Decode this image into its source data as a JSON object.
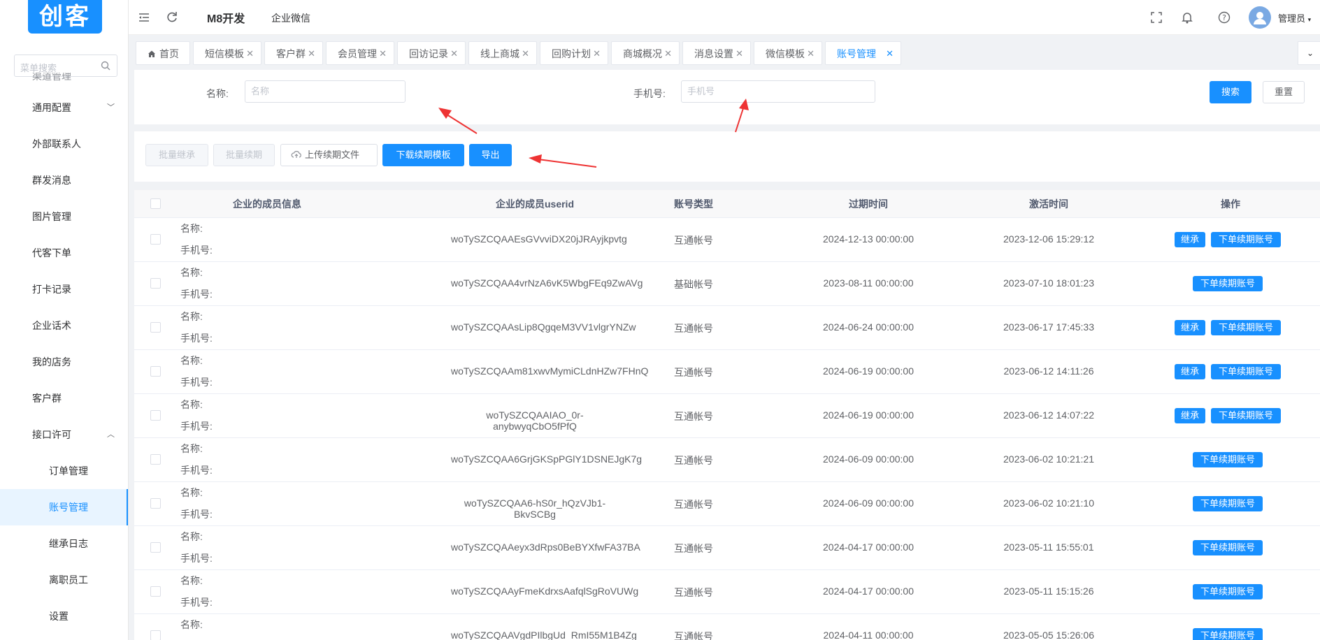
{
  "logo": "创客",
  "sidebar": {
    "search_placeholder": "菜单搜索",
    "items": [
      {
        "label": "渠道管理",
        "type": "cut"
      },
      {
        "label": "通用配置",
        "arrow": "⌄"
      },
      {
        "label": "外部联系人"
      },
      {
        "label": "群发消息"
      },
      {
        "label": "图片管理"
      },
      {
        "label": "代客下单"
      },
      {
        "label": "打卡记录"
      },
      {
        "label": "企业话术"
      },
      {
        "label": "我的店务"
      },
      {
        "label": "客户群"
      },
      {
        "label": "接口许可",
        "arrow": "⌃"
      },
      {
        "label": "订单管理",
        "sub": true
      },
      {
        "label": "账号管理",
        "sub": true,
        "active": true
      },
      {
        "label": "继承日志",
        "sub": true
      },
      {
        "label": "离职员工",
        "sub": true
      },
      {
        "label": "设置",
        "sub": true
      }
    ]
  },
  "header": {
    "title": "M8开发",
    "subtitle": "企业微信",
    "user": "管理员"
  },
  "tabs": [
    {
      "label": "首页",
      "home": true
    },
    {
      "label": "短信模板"
    },
    {
      "label": "客户群"
    },
    {
      "label": "会员管理"
    },
    {
      "label": "回访记录"
    },
    {
      "label": "线上商城"
    },
    {
      "label": "回购计划"
    },
    {
      "label": "商城概况"
    },
    {
      "label": "消息设置"
    },
    {
      "label": "微信模板"
    },
    {
      "label": "账号管理",
      "active": true
    }
  ],
  "search": {
    "name_label": "名称:",
    "name_placeholder": "名称",
    "phone_label": "手机号:",
    "phone_placeholder": "手机号",
    "search_btn": "搜索",
    "reset_btn": "重置"
  },
  "toolbar": {
    "batch_inherit": "批量继承",
    "batch_renew": "批量续期",
    "upload": "上传续期文件",
    "download_template": "下载续期模板",
    "export": "导出"
  },
  "table": {
    "headers": [
      "企业的成员信息",
      "企业的成员userid",
      "账号类型",
      "过期时间",
      "激活时间",
      "操作"
    ],
    "name_prefix": "名称:",
    "phone_prefix": "手机号:",
    "inherit_label": "继承",
    "renew_label": "下单续期账号",
    "rows": [
      {
        "userid": "woTySZCQAAEsGVvviDX20jJRAyjkpvtg",
        "type": "互通帐号",
        "expire": "2024-12-13 00:00:00",
        "activate": "2023-12-06 15:29:12",
        "inherit": true
      },
      {
        "userid": "woTySZCQAA4vrNzA6vK5WbgFEq9ZwAVg",
        "type": "基础帐号",
        "expire": "2023-08-11 00:00:00",
        "activate": "2023-07-10 18:01:23",
        "inherit": false
      },
      {
        "userid": "woTySZCQAAsLip8QgqeM3VV1vlgrYNZw",
        "type": "互通帐号",
        "expire": "2024-06-24 00:00:00",
        "activate": "2023-06-17 17:45:33",
        "inherit": true
      },
      {
        "userid": "woTySZCQAAm81xwvMymiCLdnHZw7FHnQ",
        "type": "互通帐号",
        "expire": "2024-06-19 00:00:00",
        "activate": "2023-06-12 14:11:26",
        "inherit": true
      },
      {
        "userid": "woTySZCQAAIAO_0r-anybwyqCbO5fPfQ",
        "type": "互通帐号",
        "expire": "2024-06-19 00:00:00",
        "activate": "2023-06-12 14:07:22",
        "inherit": true
      },
      {
        "userid": "woTySZCQAA6GrjGKSpPGlY1DSNEJgK7g",
        "type": "互通帐号",
        "expire": "2024-06-09 00:00:00",
        "activate": "2023-06-02 10:21:21",
        "inherit": false
      },
      {
        "userid": "woTySZCQAA6-hS0r_hQzVJb1-BkvSCBg",
        "type": "互通帐号",
        "expire": "2024-06-09 00:00:00",
        "activate": "2023-06-02 10:21:10",
        "inherit": false
      },
      {
        "userid": "woTySZCQAAeyx3dRps0BeBYXfwFA37BA",
        "type": "互通帐号",
        "expire": "2024-04-17 00:00:00",
        "activate": "2023-05-11 15:55:01",
        "inherit": false
      },
      {
        "userid": "woTySZCQAAyFmeKdrxsAafqlSgRoVUWg",
        "type": "互通帐号",
        "expire": "2024-04-17 00:00:00",
        "activate": "2023-05-11 15:15:26",
        "inherit": false
      },
      {
        "userid": "woTySZCQAAVgdPIlbgUd_RmI55M1B4Zg",
        "type": "互通帐号",
        "expire": "2024-04-11 00:00:00",
        "activate": "2023-05-05 15:26:06",
        "inherit": false
      }
    ]
  },
  "colors": {
    "primary": "#1890ff",
    "annotation_arrow": "#ee3333"
  }
}
